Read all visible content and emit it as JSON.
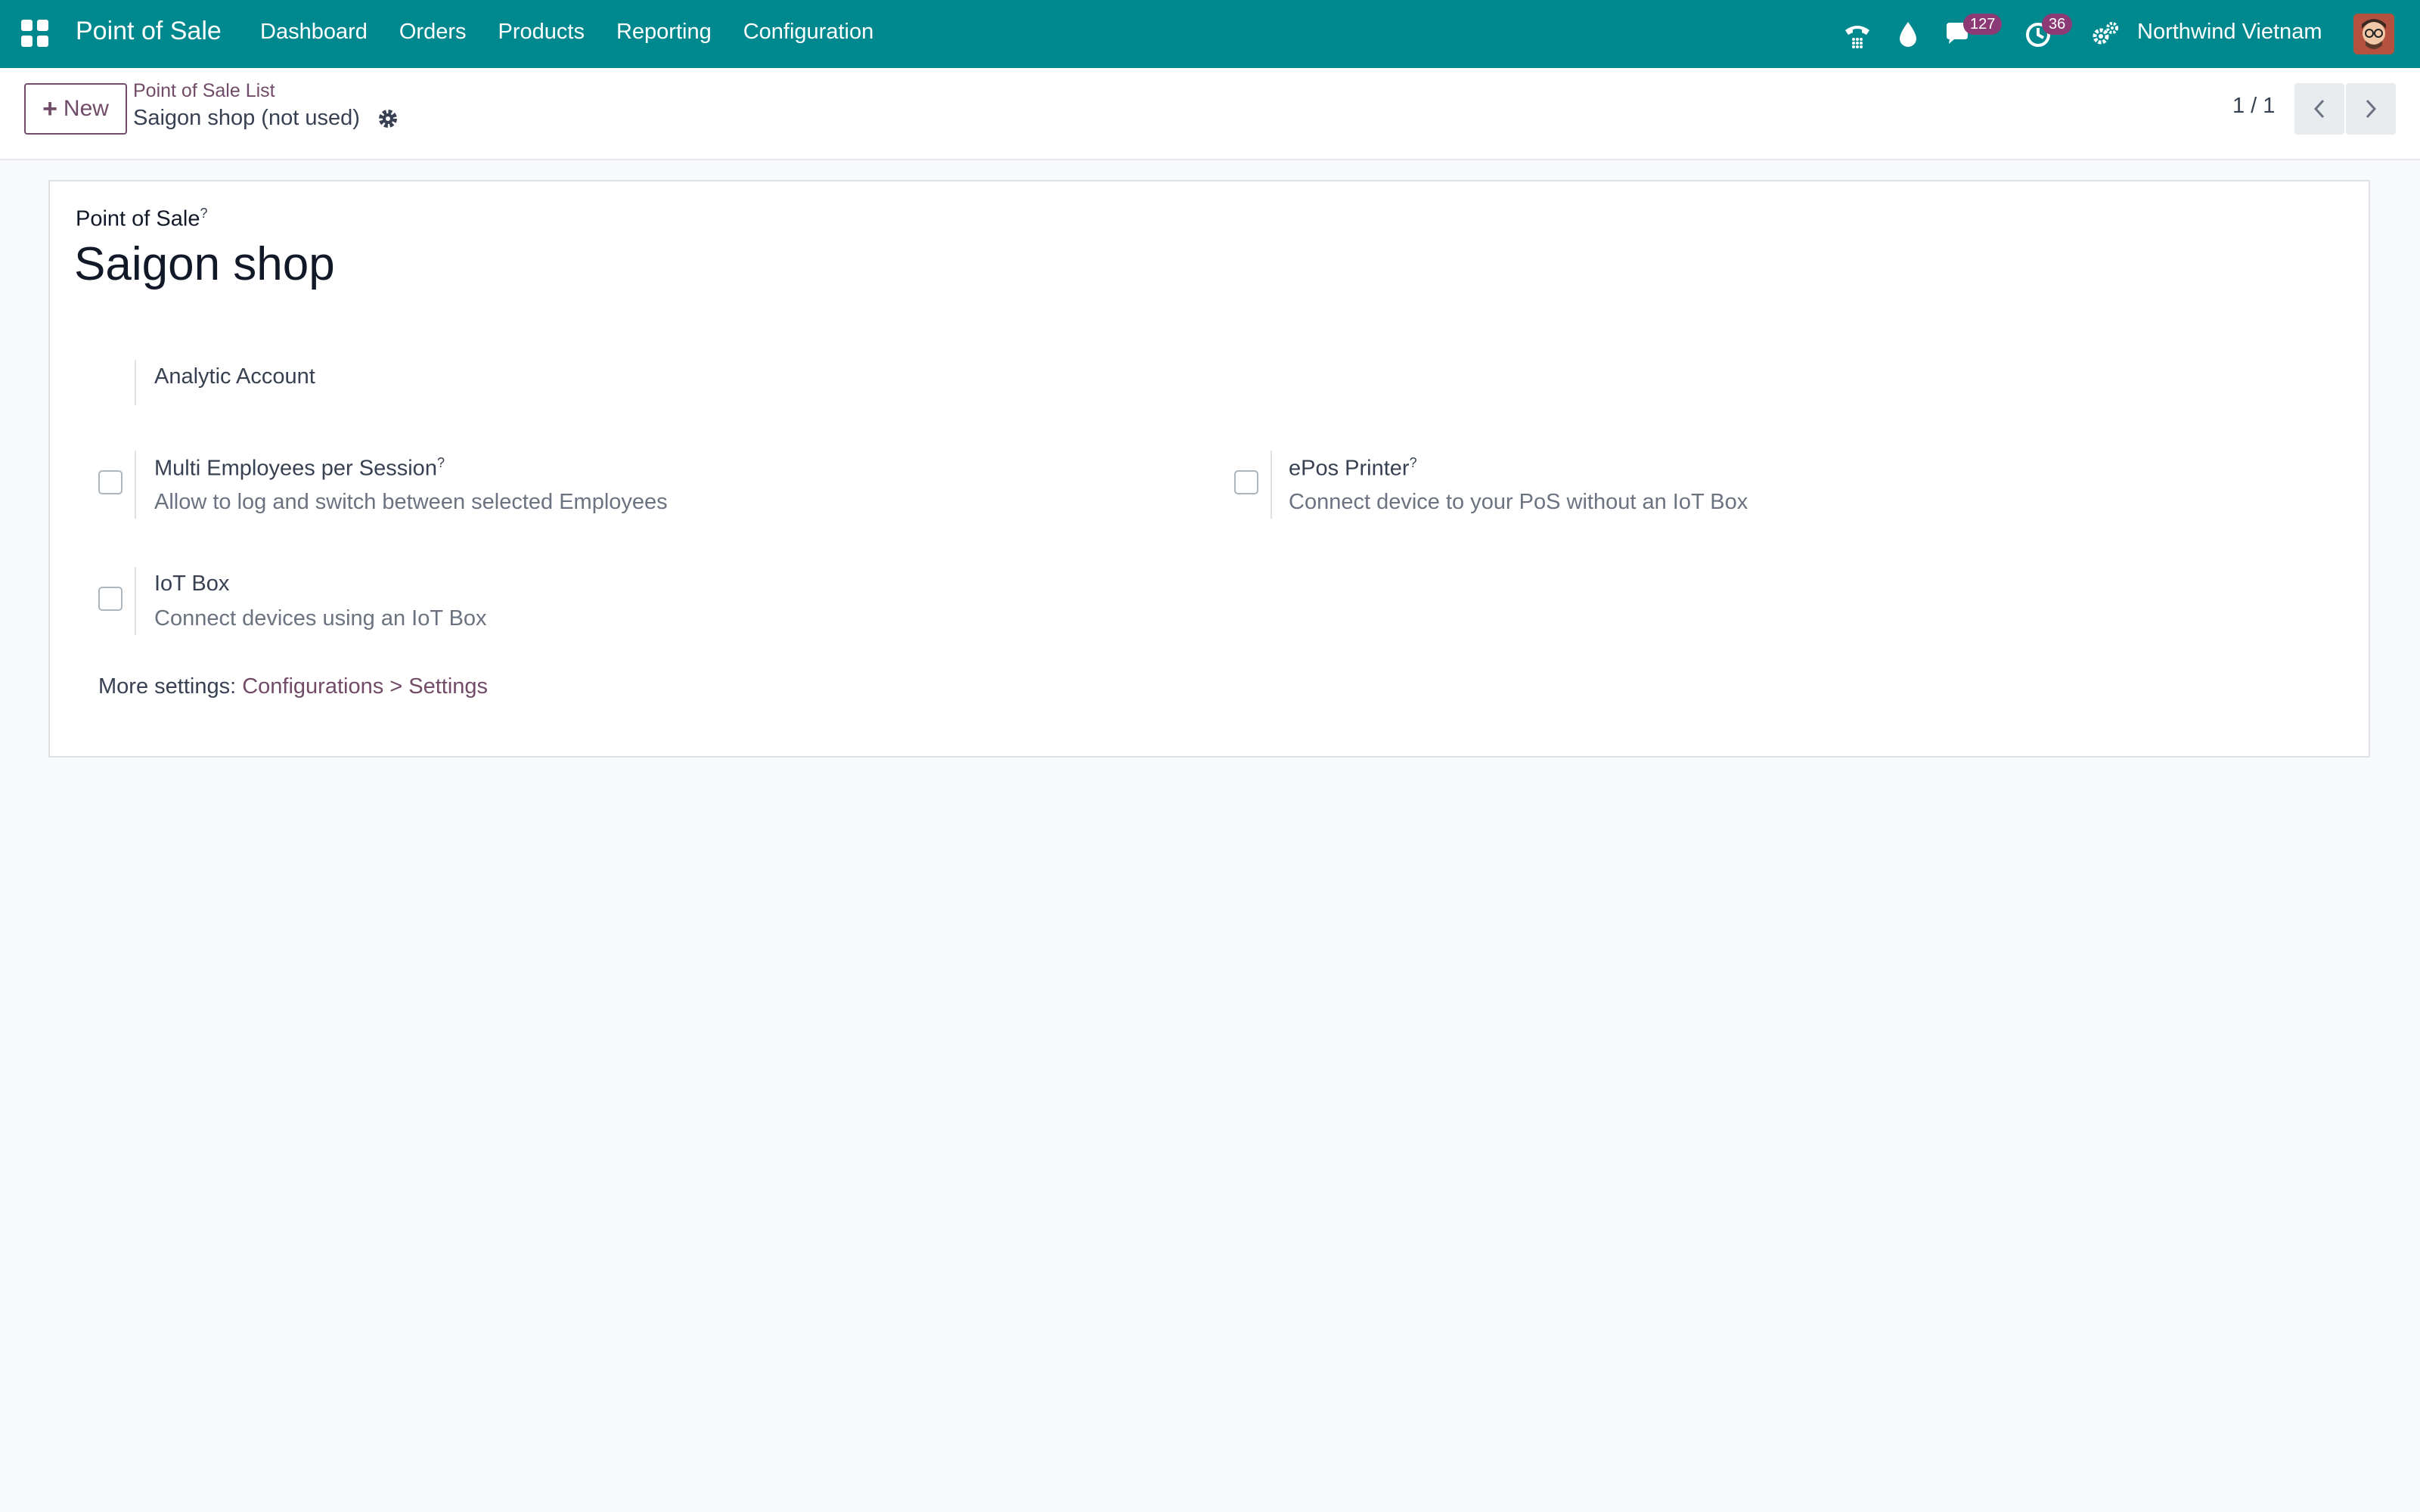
{
  "navbar": {
    "brand": "Point of Sale",
    "menu": [
      "Dashboard",
      "Orders",
      "Products",
      "Reporting",
      "Configuration"
    ],
    "messages_badge": "127",
    "activities_badge": "36",
    "company": "Northwind Vietnam",
    "icons": [
      "apps-grid-icon",
      "phone-icon",
      "droplet-icon",
      "chat-icon",
      "clock-icon",
      "settings-users-icon"
    ]
  },
  "control_panel": {
    "new_label": "New",
    "breadcrumb": "Point of Sale List",
    "record_name": "Saigon shop (not used)",
    "pager": "1 / 1"
  },
  "form": {
    "field_label": "Point of Sale",
    "field_help": "?",
    "record_title": "Saigon shop",
    "analytic_account_label": "Analytic Account",
    "settings": [
      {
        "title": "Multi Employees per Session",
        "help": "?",
        "desc": "Allow to log and switch between selected Employees",
        "checked": false
      },
      {
        "title": "ePos Printer",
        "help": "?",
        "desc": "Connect device to your PoS without an IoT Box",
        "checked": false
      },
      {
        "title": "IoT Box",
        "help": "",
        "desc": "Connect devices using an IoT Box",
        "checked": false
      }
    ],
    "more_settings_label": "More settings:",
    "more_settings_link": "Configurations > Settings"
  },
  "colors": {
    "navbar": "#00888f",
    "accent": "#714b67",
    "badge": "#8b3a75"
  }
}
